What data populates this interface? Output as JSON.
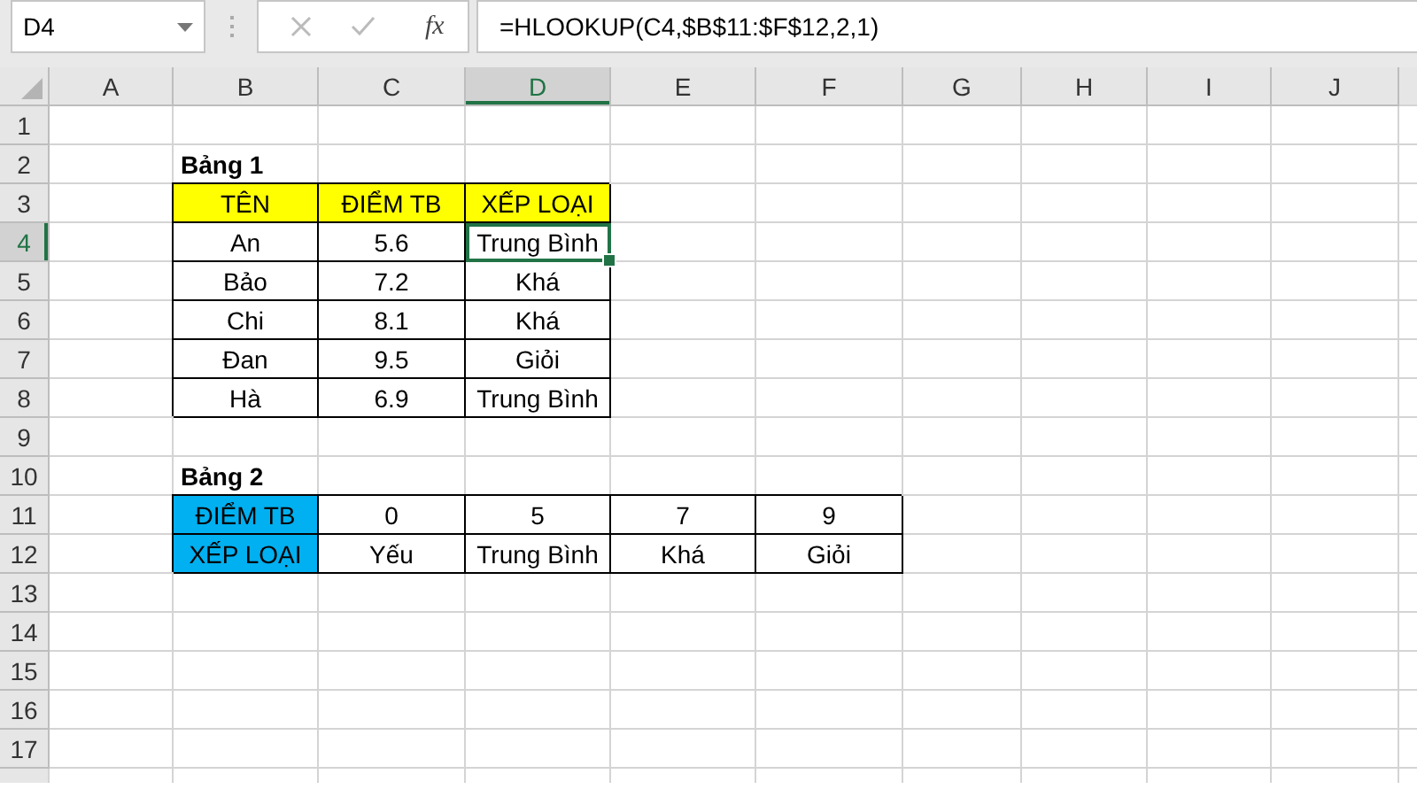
{
  "formula_bar": {
    "name_box": "D4",
    "function_label": "fx",
    "formula": "=HLOOKUP(C4,$B$11:$F$12,2,1)"
  },
  "columns": [
    {
      "label": "A",
      "selected": false
    },
    {
      "label": "B",
      "selected": false
    },
    {
      "label": "C",
      "selected": false
    },
    {
      "label": "D",
      "selected": true
    },
    {
      "label": "E",
      "selected": false
    },
    {
      "label": "F",
      "selected": false
    },
    {
      "label": "G",
      "selected": false
    },
    {
      "label": "H",
      "selected": false
    },
    {
      "label": "I",
      "selected": false
    },
    {
      "label": "J",
      "selected": false
    }
  ],
  "rows": [
    {
      "label": "1",
      "selected": false
    },
    {
      "label": "2",
      "selected": false
    },
    {
      "label": "3",
      "selected": false
    },
    {
      "label": "4",
      "selected": true
    },
    {
      "label": "5",
      "selected": false
    },
    {
      "label": "6",
      "selected": false
    },
    {
      "label": "7",
      "selected": false
    },
    {
      "label": "8",
      "selected": false
    },
    {
      "label": "9",
      "selected": false
    },
    {
      "label": "10",
      "selected": false
    },
    {
      "label": "11",
      "selected": false
    },
    {
      "label": "12",
      "selected": false
    },
    {
      "label": "13",
      "selected": false
    },
    {
      "label": "14",
      "selected": false
    },
    {
      "label": "15",
      "selected": false
    },
    {
      "label": "16",
      "selected": false
    },
    {
      "label": "17",
      "selected": false
    }
  ],
  "tables": [
    {
      "kind": "vertical",
      "title": "Bảng 1",
      "header": [
        "TÊN",
        "ĐIỂM TB",
        "XẾP LOẠI"
      ],
      "rows": [
        [
          {
            "text": "An",
            "selected": false
          },
          {
            "text": "5.6",
            "selected": false
          },
          {
            "text": "Trung Bình",
            "selected": true
          }
        ],
        [
          {
            "text": "Bảo",
            "selected": false
          },
          {
            "text": "7.2",
            "selected": false
          },
          {
            "text": "Khá",
            "selected": false
          }
        ],
        [
          {
            "text": "Chi",
            "selected": false
          },
          {
            "text": "8.1",
            "selected": false
          },
          {
            "text": "Khá",
            "selected": false
          }
        ],
        [
          {
            "text": "Đan",
            "selected": false
          },
          {
            "text": "9.5",
            "selected": false
          },
          {
            "text": "Giỏi",
            "selected": false
          }
        ],
        [
          {
            "text": "Hà",
            "selected": false
          },
          {
            "text": "6.9",
            "selected": false
          },
          {
            "text": "Trung Bình",
            "selected": false
          }
        ]
      ]
    },
    {
      "kind": "horizontal",
      "title": "Bảng 2",
      "header": [
        "ĐIỂM TB",
        "XẾP LOẠI"
      ],
      "rows": [
        [
          {
            "text": "0",
            "selected": false
          },
          {
            "text": "5",
            "selected": false
          },
          {
            "text": "7",
            "selected": false
          },
          {
            "text": "9",
            "selected": false
          }
        ],
        [
          {
            "text": "Yếu",
            "selected": false
          },
          {
            "text": "Trung Bình",
            "selected": false
          },
          {
            "text": "Khá",
            "selected": false
          },
          {
            "text": "Giỏi",
            "selected": false
          }
        ]
      ]
    }
  ]
}
